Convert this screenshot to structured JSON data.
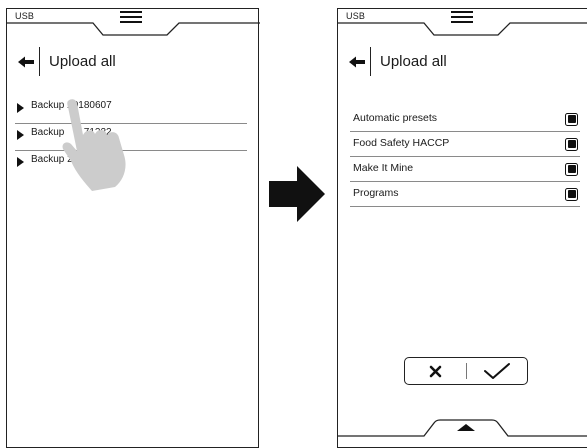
{
  "left_screen": {
    "status_label": "USB",
    "title": "Upload all",
    "backups": [
      {
        "label": "Backup 20180607"
      },
      {
        "label": "Backup       71222"
      },
      {
        "label": "Backup 2"
      }
    ]
  },
  "right_screen": {
    "status_label": "USB",
    "title": "Upload all",
    "options": [
      {
        "label": "Automatic presets",
        "checked": true
      },
      {
        "label": "Food Safety HACCP",
        "checked": true
      },
      {
        "label": "Make It Mine",
        "checked": true
      },
      {
        "label": "Programs",
        "checked": true
      }
    ]
  },
  "icons": {
    "menu": "hamburger-menu-icon",
    "back": "back-arrow-icon",
    "expand": "play-triangle-icon",
    "hand": "pointing-hand-icon",
    "flow": "right-arrow-icon",
    "cancel": "cross-icon",
    "confirm": "checkmark-icon",
    "bottom_tab": "up-chevron-icon"
  },
  "colors": {
    "ink": "#111111",
    "divider": "#8a8a8a",
    "hand": "#cccccc"
  }
}
